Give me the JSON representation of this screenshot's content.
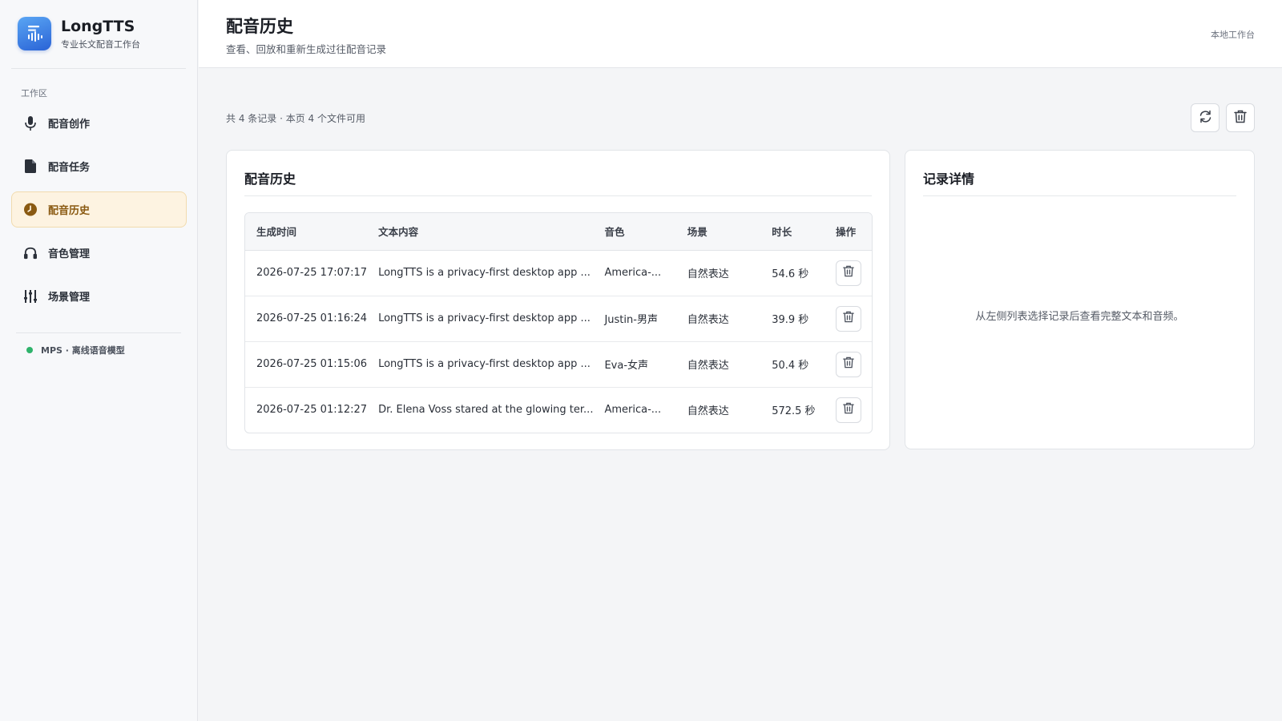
{
  "brand": {
    "name": "LongTTS",
    "subtitle": "专业长文配音工作台"
  },
  "sidebar": {
    "section": "工作区",
    "items": [
      {
        "label": "配音创作",
        "icon": "microphone-icon",
        "active": false
      },
      {
        "label": "配音任务",
        "icon": "document-icon",
        "active": false
      },
      {
        "label": "配音历史",
        "icon": "clock-icon",
        "active": true
      },
      {
        "label": "音色管理",
        "icon": "headphones-icon",
        "active": false
      },
      {
        "label": "场景管理",
        "icon": "sliders-icon",
        "active": false
      }
    ],
    "status": "MPS · 离线语音模型"
  },
  "header": {
    "title": "配音历史",
    "subtitle": "查看、回放和重新生成过往配音记录",
    "right": "本地工作台"
  },
  "toolbar": {
    "summary": "共 4 条记录 · 本页 4 个文件可用",
    "refresh_icon": "refresh-icon",
    "clear_icon": "trash-icon"
  },
  "history": {
    "title": "配音历史",
    "columns": [
      "生成时间",
      "文本内容",
      "音色",
      "场景",
      "时长",
      "操作"
    ],
    "rows": [
      {
        "time": "2026-07-25 17:07:17",
        "text": "LongTTS is a privacy-first desktop app ...",
        "voice": "America-...",
        "scene": "自然表达",
        "duration": "54.6 秒"
      },
      {
        "time": "2026-07-25 01:16:24",
        "text": "LongTTS is a privacy-first desktop app ...",
        "voice": "Justin-男声",
        "scene": "自然表达",
        "duration": "39.9 秒"
      },
      {
        "time": "2026-07-25 01:15:06",
        "text": "LongTTS is a privacy-first desktop app ...",
        "voice": "Eva-女声",
        "scene": "自然表达",
        "duration": "50.4 秒"
      },
      {
        "time": "2026-07-25 01:12:27",
        "text": "Dr. Elena Voss stared at the glowing ter...",
        "voice": "America-...",
        "scene": "自然表达",
        "duration": "572.5 秒"
      }
    ]
  },
  "detail": {
    "title": "记录详情",
    "empty": "从左侧列表选择记录后查看完整文本和音频。"
  },
  "colors": {
    "accent": "#2a63d6",
    "active_bg": "#fdf3e1",
    "active_text": "#8a5a12",
    "status_ok": "#2fb36b"
  }
}
